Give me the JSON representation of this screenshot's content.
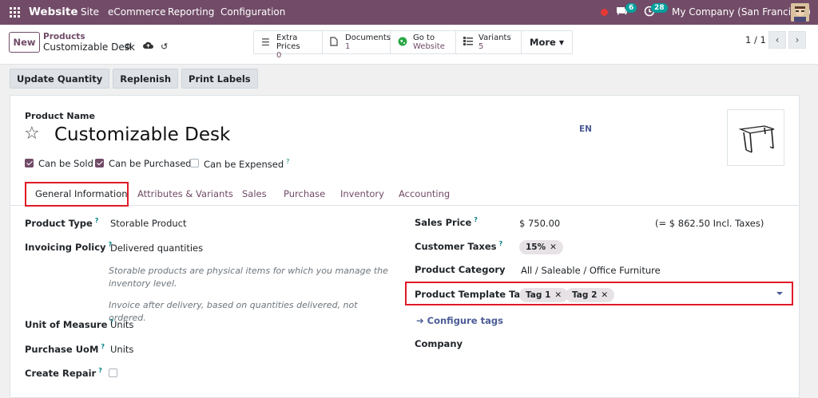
{
  "topbar": {
    "brand": "Website",
    "menu": [
      "Site",
      "eCommerce",
      "Reporting",
      "Configuration"
    ],
    "chat_count": "6",
    "activity_count": "28",
    "company": "My Company (San Francisco)"
  },
  "control": {
    "new_label": "New",
    "breadcrumb_parent": "Products",
    "breadcrumb_current": "Customizable Desk",
    "stats": [
      {
        "label": "Extra Prices",
        "value": "0",
        "icon": "list-icon"
      },
      {
        "label": "Documents",
        "value": "1",
        "icon": "document-icon"
      },
      {
        "label": "Go to",
        "value": "Website",
        "icon": "globe-icon"
      },
      {
        "label": "Variants",
        "value": "5",
        "icon": "variants-icon"
      }
    ],
    "more_label": "More",
    "pager": "1 / 1"
  },
  "actions": [
    "Update Quantity",
    "Replenish",
    "Print Labels"
  ],
  "product": {
    "name_label": "Product Name",
    "name": "Customizable Desk",
    "lang": "EN",
    "can_be_sold": "Can be Sold",
    "can_be_purchased": "Can be Purchased",
    "can_be_expensed": "Can be Expensed"
  },
  "tabs": [
    "General Information",
    "Attributes & Variants",
    "Sales",
    "Purchase",
    "Inventory",
    "Accounting"
  ],
  "left": {
    "product_type_label": "Product Type",
    "product_type": "Storable Product",
    "invoicing_policy_label": "Invoicing Policy",
    "invoicing_policy": "Delivered quantities",
    "help_storable": "Storable products are physical items for which you manage the inventory level.",
    "help_invoice": "Invoice after delivery, based on quantities delivered, not ordered.",
    "uom_label": "Unit of Measure",
    "uom": "Units",
    "purchase_uom_label": "Purchase UoM",
    "purchase_uom": "Units",
    "create_repair_label": "Create Repair"
  },
  "right": {
    "sales_price_label": "Sales Price",
    "sales_price": "$ 750.00",
    "incl_taxes": "(= $ 862.50 Incl. Taxes)",
    "customer_taxes_label": "Customer Taxes",
    "customer_tax": "15%",
    "category_label": "Product Category",
    "category": "All / Saleable / Office Furniture",
    "tags_label": "Product Template Tags",
    "tags": [
      "Tag 1",
      "Tag 2"
    ],
    "configure_tags": "Configure tags",
    "company_label": "Company"
  }
}
